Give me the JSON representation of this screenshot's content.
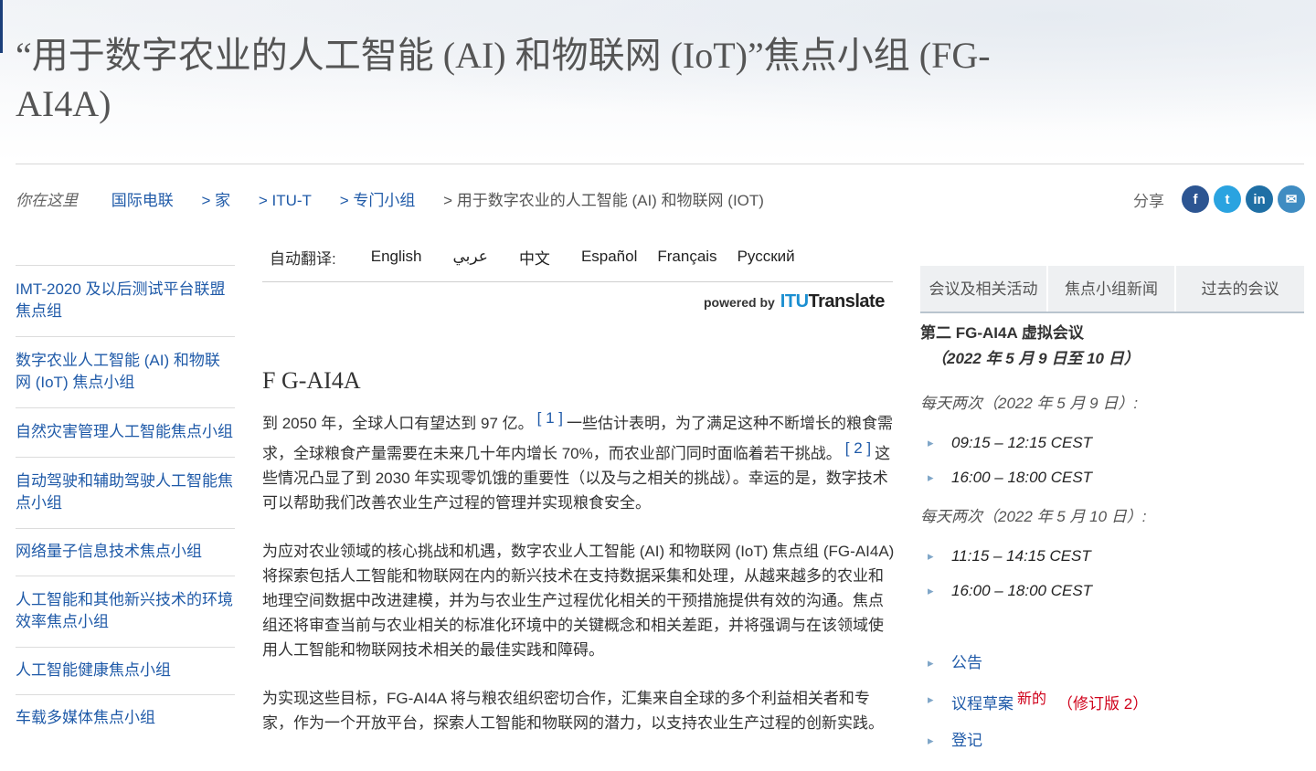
{
  "header": {
    "title": "“用于数字农业的人工智能 (AI) 和物联网 (IoT)”焦点小组 (FG-AI4A)"
  },
  "breadcrumb": {
    "you_are_here": "你在这里",
    "items": [
      "国际电联",
      "> 家",
      "> ITU-T",
      "> 专门小组",
      "> 用于数字农业的人工智能 (AI) 和物联网 (IOT)"
    ]
  },
  "share": {
    "label": "分享",
    "icons": [
      "facebook-icon",
      "twitter-icon",
      "linkedin-icon",
      "email-icon"
    ],
    "glyphs": [
      "f",
      "t",
      "in",
      "✉"
    ]
  },
  "left_nav": [
    "IMT-2020 及以后测试平台联盟焦点组",
    "数字农业人工智能 (AI) 和物联网 (IoT) 焦点小组",
    "自然灾害管理人工智能焦点小组",
    "自动驾驶和辅助驾驶人工智能焦点小组",
    "网络量子信息技术焦点小组",
    "人工智能和其他新兴技术的环境效率焦点小组",
    "人工智能健康焦点小组",
    "车载多媒体焦点小组"
  ],
  "translate": {
    "label": "自动翻译:",
    "languages": [
      "English",
      "عربي",
      "中文",
      "Español",
      "Français",
      "Русский"
    ],
    "powered_by": "powered by",
    "brand_itu": "ITU",
    "brand_translate": "Translate"
  },
  "main": {
    "heading": "F G-AI4A",
    "p1_a": "到 2050 年，全球人口有望达到 97 亿。",
    "p1_ref1": "[ 1 ]",
    "p1_b": "一些估计表明，为了满足这种不断增长的粮食需求，全球粮食产量需要在未来几十年内增长 70%，而农业部门同时面临着若干挑战。",
    "p1_ref2": "[ 2 ]",
    "p1_c": "这些情况凸显了到 2030 年实现零饥饿的重要性（以及与之相关的挑战）。幸运的是，数字技术可以帮助我们改善农业生产过程的管理并实现粮食安全。",
    "p2": "为应对农业领域的核心挑战和机遇，数字农业人工智能 (AI) 和物联网 (IoT) 焦点组 (FG-AI4A) 将探索包括人工智能和物联网在内的新兴技术在支持数据采集和处理，从越来越多的农业和地理空间数据中改进建模，并为与农业生产过程优化相关的干预措施提供有效的沟通。焦点组还将审查当前与农业相关的标准化环境中的关键概念和相关差距，并将强调与在该领域使用人工智能和物联网技术相关的最佳实践和障碍。",
    "p3": "为实现这些目标，FG-AI4A 将与粮农组织密切合作，汇集来自全球的多个利益相关者和专家，作为一个开放平台，探索人工智能和物联网的潜力，以支持农业生产过程的创新实践。"
  },
  "right": {
    "tabs": [
      "会议及相关活动",
      "焦点小组新闻",
      "过去的会议"
    ],
    "meeting_title": "第二 FG-AI4A 虚拟会议",
    "meeting_date": "（2022 年 5 月 9 日至 10 日）",
    "day1_label": "每天两次（2022 年 5 月 9 日）:",
    "day1_times": [
      "09:15 – 12:15 CEST",
      "16:00 – 18:00 CEST"
    ],
    "day2_label": "每天两次（2022 年 5 月 10 日）:",
    "day2_times": [
      "11:15 – 14:15 CEST",
      "16:00 – 18:00 CEST"
    ],
    "links": {
      "announcement": "公告",
      "agenda": "议程草案",
      "new_badge": "新的",
      "revision": "（修订版 2）",
      "register": "登记"
    }
  }
}
